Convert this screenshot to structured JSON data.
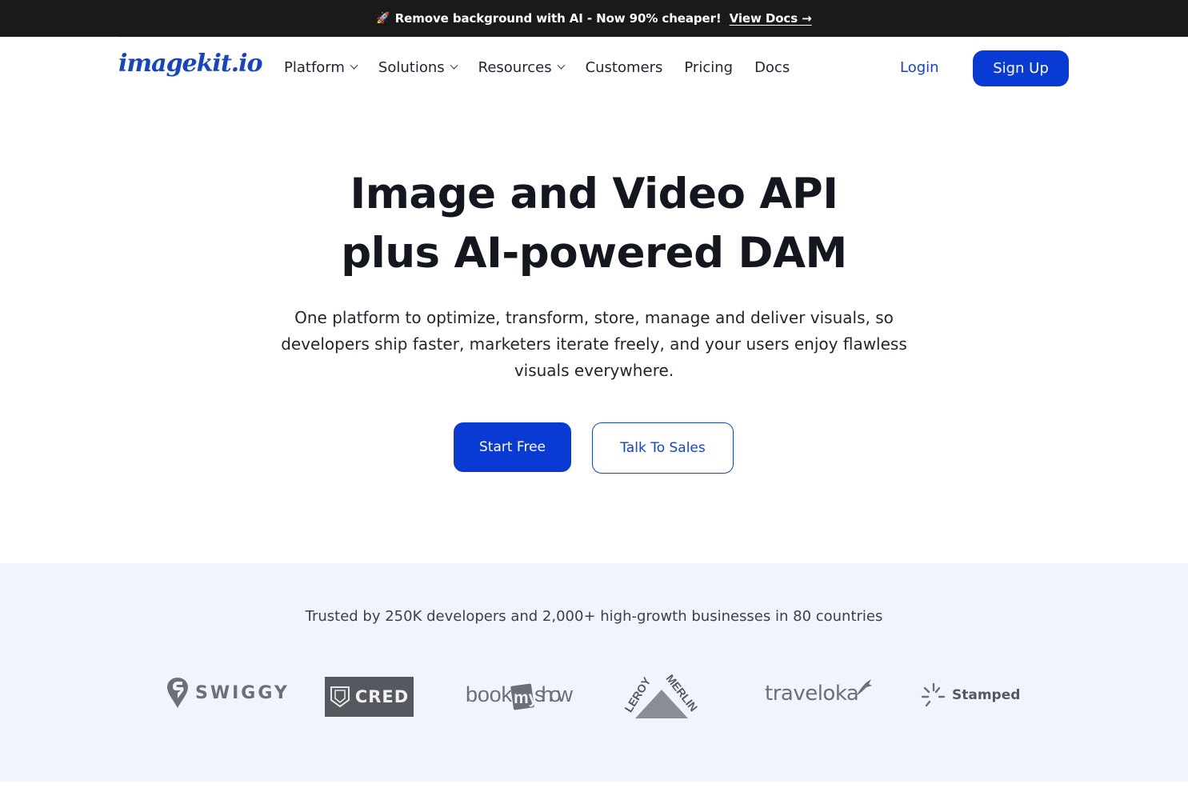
{
  "announcement": {
    "icon": "rocket-icon",
    "text": "Remove background with AI - Now 90% cheaper!",
    "link": "View Docs →"
  },
  "nav": {
    "logo": "imagekit.io",
    "items": [
      {
        "label": "Platform",
        "dropdown": true
      },
      {
        "label": "Solutions",
        "dropdown": true
      },
      {
        "label": "Resources",
        "dropdown": true
      },
      {
        "label": "Customers",
        "dropdown": false
      },
      {
        "label": "Pricing",
        "dropdown": false
      },
      {
        "label": "Docs",
        "dropdown": false
      }
    ],
    "login": "Login",
    "signup": "Sign Up"
  },
  "hero": {
    "title_line1": "Image and Video API",
    "title_line2": "plus AI-powered DAM",
    "subtitle": "One platform to optimize, transform, store, manage and deliver visuals, so developers ship faster, marketers iterate freely, and your users enjoy flawless visuals everywhere.",
    "primary_cta": "Start Free",
    "secondary_cta": "Talk To Sales"
  },
  "trust": {
    "text": "Trusted by 250K developers and 2,000+ high-growth businesses in 80 countries",
    "logos": [
      "SWIGGY",
      "CRED",
      "bookmyshow",
      "LEROY MERLIN",
      "traveloka",
      "Stamped"
    ]
  },
  "colors": {
    "accent": "#0a3ad4",
    "link": "#1644c2",
    "banner_bg": "#1a1a1a",
    "trust_bg": "#f0f4fd"
  }
}
